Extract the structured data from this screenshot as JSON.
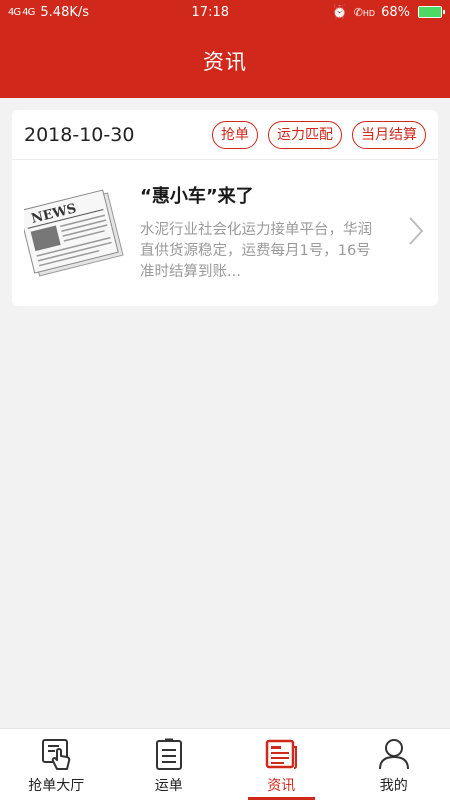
{
  "status_bar": {
    "signal_text": "4G 4G",
    "speed": "5.48K/s",
    "time": "17:18",
    "call_label": "HD",
    "battery": "68%"
  },
  "header": {
    "title": "资讯"
  },
  "card": {
    "date": "2018-10-30",
    "tags": [
      "抢单",
      "运力匹配",
      "当月结算"
    ],
    "news": {
      "thumbnail_text": "NEWS",
      "title": "“惠小车”来了",
      "summary": "水泥行业社会化运力接单平台，华润直供货源稳定，运费每月1号，16号准时结算到账..."
    }
  },
  "tabbar": {
    "items": [
      {
        "label": "抢单大厅",
        "icon": "hand-tap-icon",
        "active": false
      },
      {
        "label": "运单",
        "icon": "clipboard-icon",
        "active": false
      },
      {
        "label": "资讯",
        "icon": "newspaper-icon",
        "active": true
      },
      {
        "label": "我的",
        "icon": "user-icon",
        "active": false
      }
    ]
  },
  "colors": {
    "brand": "#d0281b",
    "background": "#f2f2f2",
    "summary_text": "#9a9a9a"
  }
}
